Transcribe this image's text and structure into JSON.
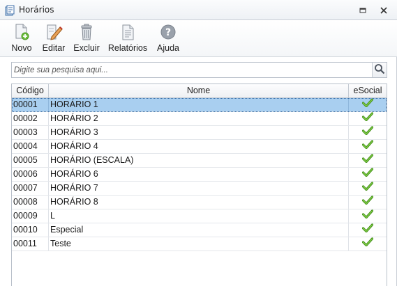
{
  "window": {
    "title": "Horários",
    "icon": "schedule-app-icon",
    "controls": [
      "restore-icon",
      "close-icon"
    ]
  },
  "toolbar": {
    "items": [
      {
        "label": "Novo",
        "icon": "new-document-icon"
      },
      {
        "label": "Editar",
        "icon": "edit-pencil-icon"
      },
      {
        "label": "Excluir",
        "icon": "trash-icon"
      },
      {
        "label": "Relatórios",
        "icon": "report-icon"
      },
      {
        "label": "Ajuda",
        "icon": "help-icon"
      }
    ]
  },
  "search": {
    "placeholder": "Digite sua pesquisa aqui...",
    "value": ""
  },
  "table": {
    "columns": [
      "Código",
      "Nome",
      "eSocial"
    ],
    "selected_index": 0,
    "rows": [
      {
        "codigo": "00001",
        "nome": "HORÁRIO 1",
        "esocial": true
      },
      {
        "codigo": "00002",
        "nome": "HORÁRIO 2",
        "esocial": true
      },
      {
        "codigo": "00003",
        "nome": "HORÁRIO 3",
        "esocial": true
      },
      {
        "codigo": "00004",
        "nome": "HORÁRIO 4",
        "esocial": true
      },
      {
        "codigo": "00005",
        "nome": "HORÁRIO (ESCALA)",
        "esocial": true
      },
      {
        "codigo": "00006",
        "nome": "HORÁRIO 6",
        "esocial": true
      },
      {
        "codigo": "00007",
        "nome": "HORÁRIO 7",
        "esocial": true
      },
      {
        "codigo": "00008",
        "nome": "HORÁRIO 8",
        "esocial": true
      },
      {
        "codigo": "00009",
        "nome": "L",
        "esocial": true
      },
      {
        "codigo": "00010",
        "nome": "Especial",
        "esocial": true
      },
      {
        "codigo": "00011",
        "nome": "Teste",
        "esocial": true
      }
    ]
  },
  "colors": {
    "selected_row": "#a9cff0",
    "check": "#5aa623"
  }
}
